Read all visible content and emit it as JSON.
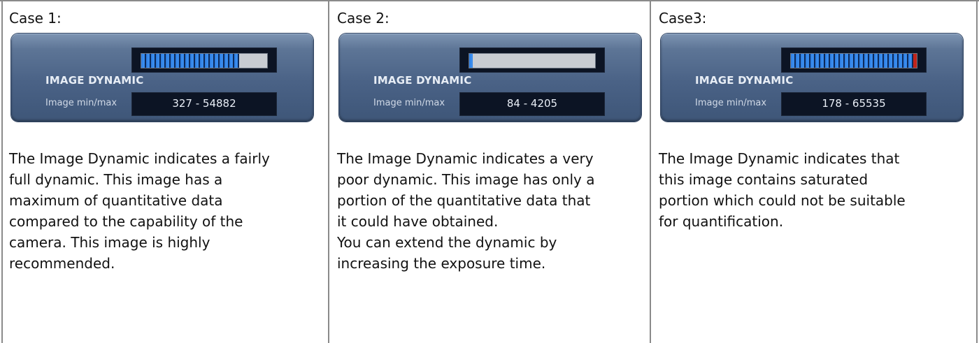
{
  "cases": [
    {
      "title": "Case 1:",
      "panel": {
        "header": "IMAGE DYNAMIC",
        "minmax_label": "Image min/max",
        "minmax_value": "327 - 54882",
        "dynamic_fill_fraction": 0.78,
        "saturated": false
      },
      "description": [
        "The Image Dynamic indicates a fairly",
        "full dynamic. This image has a",
        "maximum of quantitative data",
        "compared to the capability of the",
        "camera. This image is highly",
        "recommended."
      ]
    },
    {
      "title": "Case 2:",
      "panel": {
        "header": "IMAGE DYNAMIC",
        "minmax_label": "Image min/max",
        "minmax_value": "84 - 4205",
        "dynamic_fill_fraction": 0.03,
        "saturated": false
      },
      "description": [
        "The Image Dynamic indicates a very",
        "poor dynamic. This image has only a",
        "portion of the quantitative data that",
        "it could have obtained.",
        "You can extend the dynamic by",
        "increasing the exposure time."
      ]
    },
    {
      "title": "Case3:",
      "panel": {
        "header": "IMAGE DYNAMIC",
        "minmax_label": "Image min/max",
        "minmax_value": "178 - 65535",
        "dynamic_fill_fraction": 1.0,
        "saturated": true
      },
      "description": [
        "The Image Dynamic indicates that",
        "this image contains saturated",
        "portion which could not be suitable",
        "for quantification."
      ]
    }
  ],
  "colors": {
    "panel": "#4a6286",
    "bar_fill": "#2c7be0",
    "bar_track": "#c8ccd2",
    "saturation": "#c0241a",
    "readout_bg": "#0c1424"
  }
}
